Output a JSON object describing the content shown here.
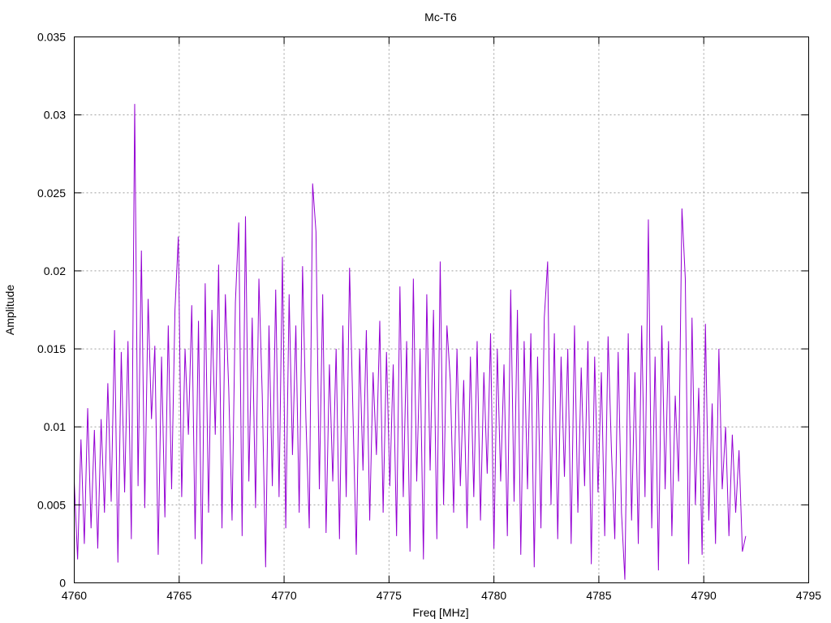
{
  "chart_data": {
    "type": "line",
    "title": "Mc-T6",
    "xlabel": "Freq [MHz]",
    "ylabel": "Amplitude",
    "xlim": [
      4760,
      4795
    ],
    "ylim": [
      0,
      0.035
    ],
    "xticks": [
      "4760",
      "4765",
      "4770",
      "4775",
      "4780",
      "4785",
      "4790",
      "4795"
    ],
    "yticks": [
      "0",
      "0.005",
      "0.01",
      "0.015",
      "0.02",
      "0.025",
      "0.03",
      "0.035"
    ],
    "grid": true,
    "series": [
      {
        "name": "Mc-T6",
        "color": "#9400d3",
        "x_start": 4760,
        "x_step": 0.16,
        "values": [
          0.0065,
          0.0015,
          0.0092,
          0.0025,
          0.0112,
          0.0035,
          0.0098,
          0.0022,
          0.0105,
          0.0045,
          0.0128,
          0.0052,
          0.0162,
          0.0013,
          0.0148,
          0.0058,
          0.0155,
          0.0028,
          0.0307,
          0.0062,
          0.0213,
          0.0048,
          0.0182,
          0.0105,
          0.0152,
          0.0018,
          0.0145,
          0.0042,
          0.0165,
          0.006,
          0.0175,
          0.0222,
          0.0055,
          0.015,
          0.0095,
          0.0178,
          0.0028,
          0.0168,
          0.0012,
          0.0192,
          0.0045,
          0.0175,
          0.0095,
          0.0204,
          0.0035,
          0.0185,
          0.0125,
          0.004,
          0.018,
          0.0231,
          0.003,
          0.0235,
          0.0065,
          0.017,
          0.0048,
          0.0195,
          0.012,
          0.001,
          0.0165,
          0.0062,
          0.0188,
          0.0055,
          0.0209,
          0.0035,
          0.0185,
          0.0082,
          0.0165,
          0.0045,
          0.0203,
          0.0105,
          0.0035,
          0.0256,
          0.0225,
          0.006,
          0.0185,
          0.0032,
          0.014,
          0.0065,
          0.015,
          0.0028,
          0.0165,
          0.0055,
          0.0202,
          0.011,
          0.0018,
          0.015,
          0.0072,
          0.0162,
          0.004,
          0.0135,
          0.0082,
          0.0168,
          0.0045,
          0.0148,
          0.0062,
          0.014,
          0.003,
          0.019,
          0.0055,
          0.0155,
          0.002,
          0.0195,
          0.0065,
          0.015,
          0.0015,
          0.0185,
          0.0072,
          0.0175,
          0.0028,
          0.0206,
          0.005,
          0.0165,
          0.013,
          0.0045,
          0.015,
          0.0062,
          0.013,
          0.0035,
          0.0145,
          0.0055,
          0.0155,
          0.004,
          0.0135,
          0.007,
          0.016,
          0.0022,
          0.015,
          0.0065,
          0.014,
          0.003,
          0.0188,
          0.0052,
          0.0175,
          0.0018,
          0.0155,
          0.006,
          0.016,
          0.001,
          0.0145,
          0.0035,
          0.017,
          0.0206,
          0.005,
          0.016,
          0.0028,
          0.0145,
          0.0068,
          0.015,
          0.0025,
          0.0165,
          0.0045,
          0.0138,
          0.0062,
          0.0155,
          0.0012,
          0.0145,
          0.0058,
          0.0135,
          0.003,
          0.0158,
          0.0085,
          0.0028,
          0.0148,
          0.0045,
          0.0002,
          0.016,
          0.004,
          0.0135,
          0.0025,
          0.0165,
          0.0055,
          0.0233,
          0.0035,
          0.0145,
          0.0008,
          0.0165,
          0.006,
          0.0155,
          0.003,
          0.012,
          0.0065,
          0.024,
          0.0195,
          0.0012,
          0.017,
          0.005,
          0.0125,
          0.0018,
          0.0166,
          0.004,
          0.0115,
          0.0025,
          0.015,
          0.006,
          0.01,
          0.003,
          0.0095,
          0.0045,
          0.0085,
          0.002,
          0.003
        ]
      }
    ]
  }
}
